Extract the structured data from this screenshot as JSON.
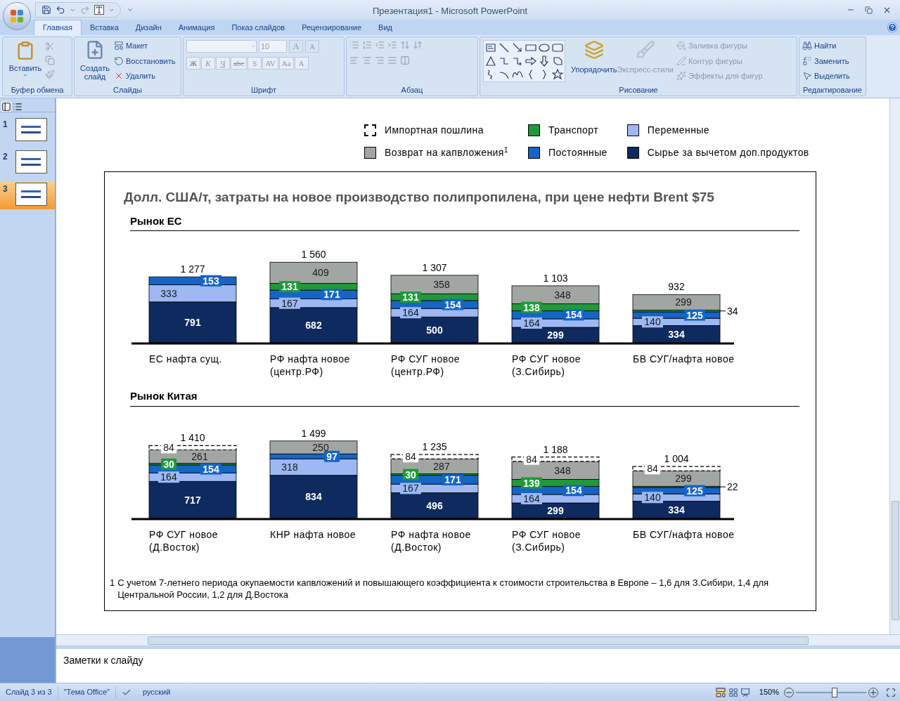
{
  "window": {
    "title": "Презентация1 - Microsoft PowerPoint"
  },
  "tabs": [
    {
      "label": "Главная",
      "selected": true
    },
    {
      "label": "Вставка",
      "selected": false
    },
    {
      "label": "Дизайн",
      "selected": false
    },
    {
      "label": "Анимация",
      "selected": false
    },
    {
      "label": "Показ слайдов",
      "selected": false
    },
    {
      "label": "Рецензирование",
      "selected": false
    },
    {
      "label": "Вид",
      "selected": false
    }
  ],
  "ribbon": {
    "clipboard": {
      "label": "Буфер обмена",
      "paste": "Вставить"
    },
    "slides": {
      "label": "Слайды",
      "new_slide": "Создать слайд",
      "items": [
        "Макет",
        "Восстановить",
        "Удалить"
      ]
    },
    "font": {
      "label": "Шрифт",
      "size": "10",
      "size_buttons": [
        "A",
        "A"
      ],
      "buttons": [
        "Ж",
        "К",
        "Ч",
        "abc",
        "S",
        "AV",
        "Aa",
        "A"
      ]
    },
    "paragraph": {
      "label": "Абзац"
    },
    "drawing": {
      "label": "Рисование",
      "arrange": {
        "label": "Упорядочить",
        "disabled": false
      },
      "quick_styles": {
        "label": "Экспресс-стили",
        "disabled": true
      },
      "items": [
        {
          "label": "Заливка фигуры",
          "disabled": true
        },
        {
          "label": "Контур фигуры",
          "disabled": true
        },
        {
          "label": "Эффекты для фигур",
          "disabled": true
        }
      ]
    },
    "editing": {
      "label": "Редактирование",
      "items": [
        "Найти",
        "Заменить",
        "Выделить"
      ]
    }
  },
  "slides_panel": [
    {
      "number": "1",
      "selected": false
    },
    {
      "number": "2",
      "selected": false
    },
    {
      "number": "3",
      "selected": true
    }
  ],
  "slide": {
    "title": "Долл. США/т, затраты на новое производство полипропилена, при цене нефти Brent $75",
    "markets": [
      {
        "title": "Рынок ЕС",
        "totals": [
          "1 277",
          "1 560",
          "1 307",
          "1 103",
          "932"
        ],
        "chart_data": {
          "type": "bar",
          "stacked": true,
          "orientation": "vertical",
          "data_labels": true,
          "categories": [
            "ЕС нафта сущ.",
            "РФ нафта новое\n(центр.РФ)",
            "РФ СУГ новое\n(центр.РФ)",
            "РФ СУГ новое\n(З.Сибирь)",
            "БВ СУГ/нафта новое"
          ],
          "series": [
            {
              "name": "Сырье за вычетом доп.продуктов",
              "color": "#0f2a5e",
              "values": [
                791,
                682,
                500,
                299,
                334
              ]
            },
            {
              "name": "Переменные",
              "color": "#9db8f2",
              "values": [
                333,
                167,
                164,
                164,
                140
              ]
            },
            {
              "name": "Постоянные",
              "color": "#1565c8",
              "values": [
                153,
                171,
                154,
                154,
                125
              ]
            },
            {
              "name": "Транспорт",
              "color": "#1f9a3a",
              "values": [
                null,
                131,
                131,
                138,
                34
              ]
            },
            {
              "name": "Возврат на капвложения$^{1}$",
              "color": "#a2a6a3",
              "values": [
                null,
                409,
                358,
                348,
                299
              ]
            },
            {
              "name": "Импортная пошлина",
              "color": "#ffffff",
              "values": [
                null,
                null,
                null,
                null,
                null
              ]
            }
          ]
        }
      },
      {
        "title": "Рынок Китая",
        "totals": [
          "1 410",
          "1 499",
          "1 235",
          "1 188",
          "1 004"
        ],
        "chart_data": {
          "type": "bar",
          "stacked": true,
          "orientation": "vertical",
          "data_labels": true,
          "categories": [
            "РФ СУГ новое\n(Д.Восток)",
            "КНР нафта новое",
            "РФ нафта новое\n(Д.Восток)",
            "РФ СУГ новое\n(З.Сибирь)",
            "БВ СУГ/нафта новое"
          ],
          "series": [
            {
              "color": "#0f2a5e",
              "values": [
                717,
                834,
                496,
                299,
                334
              ]
            },
            {
              "color": "#9db8f2",
              "values": [
                164,
                318,
                167,
                164,
                140
              ]
            },
            {
              "color": "#1565c8",
              "values": [
                154,
                97,
                171,
                154,
                125
              ]
            },
            {
              "color": "#1f9a3a",
              "values": [
                30,
                null,
                30,
                139,
                22
              ]
            },
            {
              "color": "#a2a6a3",
              "values": [
                261,
                250,
                287,
                348,
                299
              ]
            },
            {
              "color": "#ffffff",
              "values": [
                84,
                null,
                84,
                84,
                84
              ]
            }
          ]
        }
      }
    ],
    "footnote": {
      "marker": "1",
      "text": "С учетом 7-летнего периода окупаемости капвложений и повышающего коэффициента к стоимости строительства в Европе – 1,6 для З.Сибири, 1,4 для Центральной России, 1,2 для Д.Востока"
    }
  },
  "notes": {
    "text": "Заметки к слайду"
  },
  "status_bar": {
    "slide": "Слайд 3 из 3",
    "theme": "\"Тема Office\"",
    "language": "русский",
    "zoom": "150%",
    "zoom_slider": {
      "level": 0.55
    }
  }
}
